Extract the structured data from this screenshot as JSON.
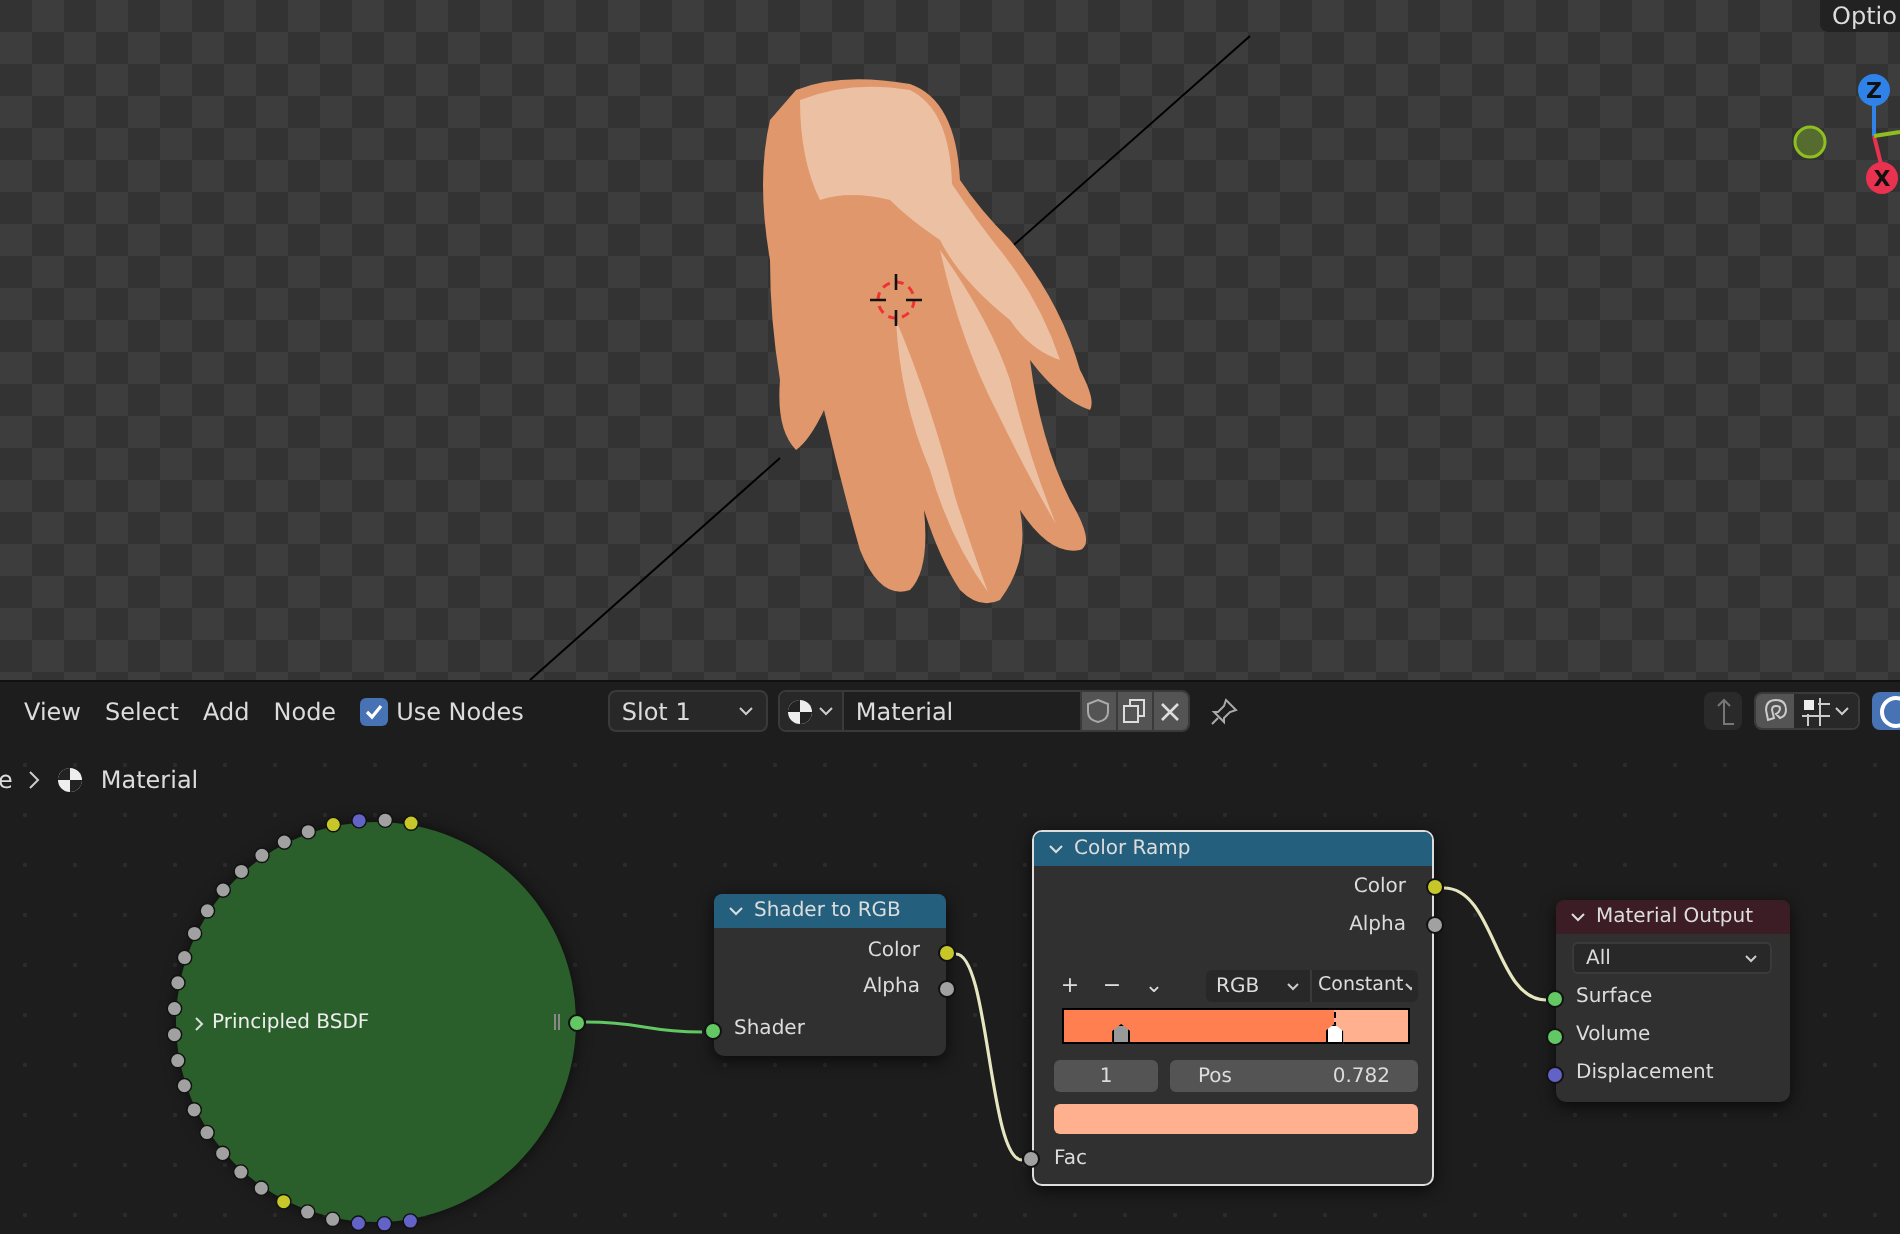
{
  "viewport": {
    "options_label": "Optio",
    "gizmo": [
      {
        "label": "Z",
        "color": "#2f83e8"
      },
      {
        "label": "X",
        "color": "#e8324f"
      }
    ]
  },
  "header": {
    "menus": [
      "View",
      "Select",
      "Add",
      "Node"
    ],
    "use_nodes": {
      "label": "Use Nodes",
      "checked": true
    },
    "slot": "Slot 1",
    "material": "Material"
  },
  "breadcrumb": [
    "e",
    "Material"
  ],
  "nodes": {
    "principled": {
      "title": "Principled BSDF"
    },
    "shader_to_rgb": {
      "title": "Shader to RGB",
      "outputs": [
        {
          "label": "Color",
          "color": "#c7c729"
        },
        {
          "label": "Alpha",
          "color": "#a1a1a1"
        }
      ],
      "inputs": [
        {
          "label": "Shader",
          "color": "#63c763"
        }
      ]
    },
    "color_ramp": {
      "title": "Color Ramp",
      "outputs": [
        {
          "label": "Color",
          "color": "#c7c729"
        },
        {
          "label": "Alpha",
          "color": "#a1a1a1"
        }
      ],
      "tools": [
        "+",
        "−",
        "⌄"
      ],
      "color_mode": "RGB",
      "interpolation": "Constant",
      "stops": [
        {
          "level": 0.17,
          "color": "#ff7f50",
          "selected": false
        },
        {
          "level": 0.782,
          "color": "#ffb08f",
          "selected": true
        }
      ],
      "active_index": "1",
      "pos_label": "Pos",
      "pos_value": "0.782",
      "inputs": [
        {
          "label": "Fac",
          "color": "#a1a1a1"
        }
      ]
    },
    "material_output": {
      "title": "Material Output",
      "target": "All",
      "inputs": [
        {
          "label": "Surface",
          "color": "#63c763"
        },
        {
          "label": "Volume",
          "color": "#63c763"
        },
        {
          "label": "Displacement",
          "color": "#6363c7"
        }
      ]
    }
  }
}
